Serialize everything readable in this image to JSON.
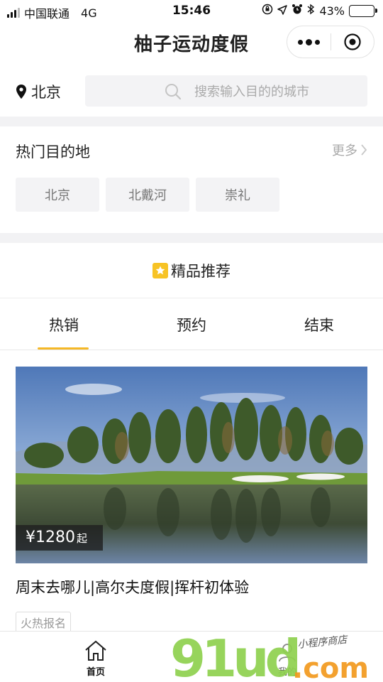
{
  "status_bar": {
    "carrier": "中国联通",
    "network": "4G",
    "time": "15:46",
    "battery": "43%",
    "battery_level": 0.43
  },
  "navbar": {
    "title": "柚子运动度假"
  },
  "location": {
    "city": "北京",
    "icon": "location-pin-icon"
  },
  "search": {
    "placeholder": "搜索输入目的的城市"
  },
  "hot_destinations": {
    "title": "热门目的地",
    "more_label": "更多",
    "items": [
      "北京",
      "北戴河",
      "崇礼"
    ]
  },
  "featured": {
    "title": "精品推荐"
  },
  "tabs": [
    {
      "label": "热销",
      "active": true
    },
    {
      "label": "预约",
      "active": false
    },
    {
      "label": "结束",
      "active": false
    }
  ],
  "product": {
    "price_prefix": "¥",
    "price": "1280",
    "price_suffix": "起",
    "title": "周末去哪儿|高尔夫度假|挥杆初体验",
    "tag": "火热报名"
  },
  "tabbar": [
    {
      "label": "首页",
      "icon": "home-icon",
      "active": true
    },
    {
      "label": "我的",
      "icon": "user-icon",
      "active": false
    }
  ],
  "watermark": {
    "brand": "91ud",
    "domain": ".com",
    "tagline": "小程序商店"
  },
  "colors": {
    "accent": "#f5b827",
    "star": "#f7c325"
  }
}
